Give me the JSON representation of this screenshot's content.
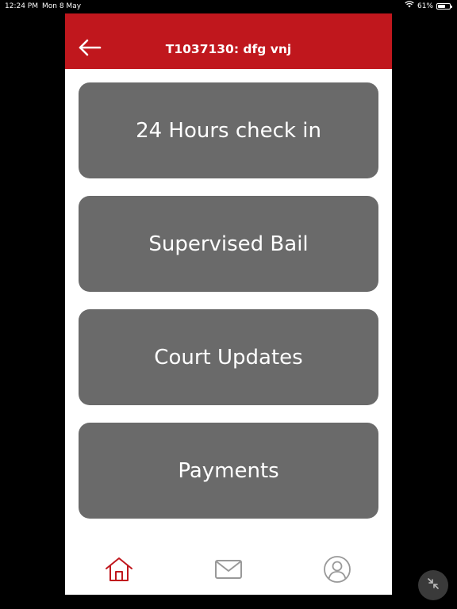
{
  "status_bar": {
    "time": "12:24 PM",
    "date": "Mon 8 May",
    "battery": "61%",
    "battery_level": 0.61,
    "icons": [
      "wifi-icon",
      "battery-icon"
    ]
  },
  "header": {
    "title": "T1037130: dfg vnj",
    "back_icon": "arrow-left-icon"
  },
  "menu": [
    {
      "label": "24 Hours check in"
    },
    {
      "label": "Supervised Bail"
    },
    {
      "label": "Court Updates"
    },
    {
      "label": "Payments"
    }
  ],
  "tabs": [
    {
      "icon": "home-icon",
      "active": true
    },
    {
      "icon": "mail-icon",
      "active": false
    },
    {
      "icon": "profile-icon",
      "active": false
    }
  ],
  "colors": {
    "header": "#c0171d",
    "card": "#6a6a6a",
    "tab_active": "#c0171d",
    "tab_inactive": "#999999"
  },
  "overlay": {
    "collapse_icon": "collapse-arrows-icon"
  }
}
